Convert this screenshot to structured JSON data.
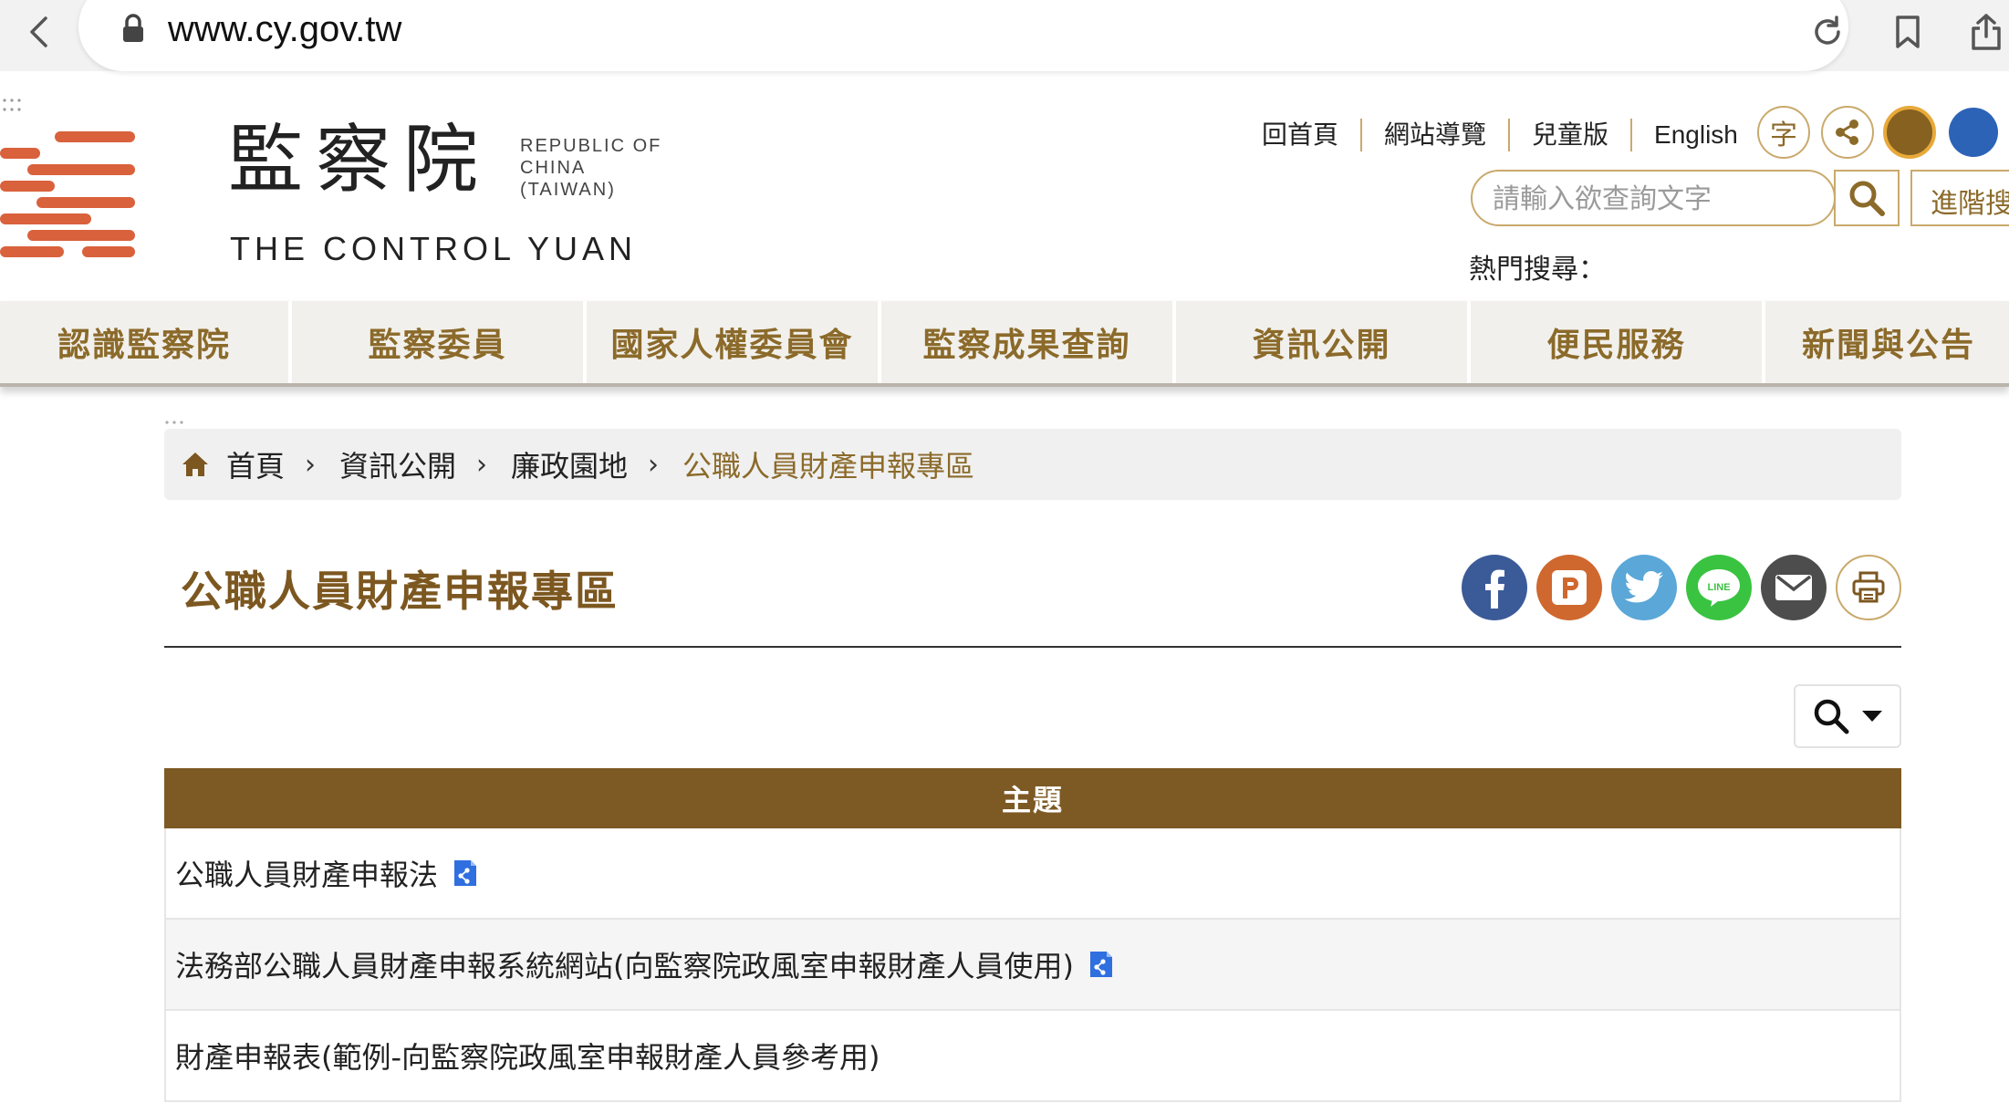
{
  "browser": {
    "url": "www.cy.gov.tw"
  },
  "header": {
    "logo_cn": "監察院",
    "logo_roc_lines": [
      "REPUBLIC OF",
      "CHINA",
      "(TAIWAN)"
    ],
    "logo_en": "THE CONTROL YUAN",
    "top_links": [
      "回首頁",
      "網站導覽",
      "兒童版",
      "English"
    ],
    "font_size_label": "字",
    "search_placeholder": "請輸入欲查詢文字",
    "advanced_search_label": "進階搜",
    "hot_search_label": "熱門搜尋："
  },
  "nav": {
    "items": [
      "認識監察院",
      "監察委員",
      "國家人權委員會",
      "監察成果查詢",
      "資訊公開",
      "便民服務",
      "新聞與公告"
    ]
  },
  "breadcrumb": {
    "items": [
      "首頁",
      "資訊公開",
      "廉政園地",
      "公職人員財產申報專區"
    ],
    "separator": "›"
  },
  "page": {
    "title": "公職人員財產申報專區"
  },
  "share": {
    "line_label": "LINE"
  },
  "table": {
    "header": "主題",
    "rows": [
      {
        "text": "公職人員財產申報法",
        "has_icon": true
      },
      {
        "text": "法務部公職人員財產申報系統網站(向監察院政風室申報財產人員使用)",
        "has_icon": true
      },
      {
        "text": "財產申報表(範例-向監察院政風室申報財產人員參考用)",
        "has_icon": false
      }
    ]
  },
  "colors": {
    "brand_brown": "#7d5a24",
    "nav_text": "#8b6a2a",
    "logo_red": "#d9613c",
    "facebook": "#3b5a98",
    "plurk": "#cf682f",
    "twitter": "#5aa7d8",
    "line": "#3ac341",
    "email": "#4d4d4d"
  }
}
